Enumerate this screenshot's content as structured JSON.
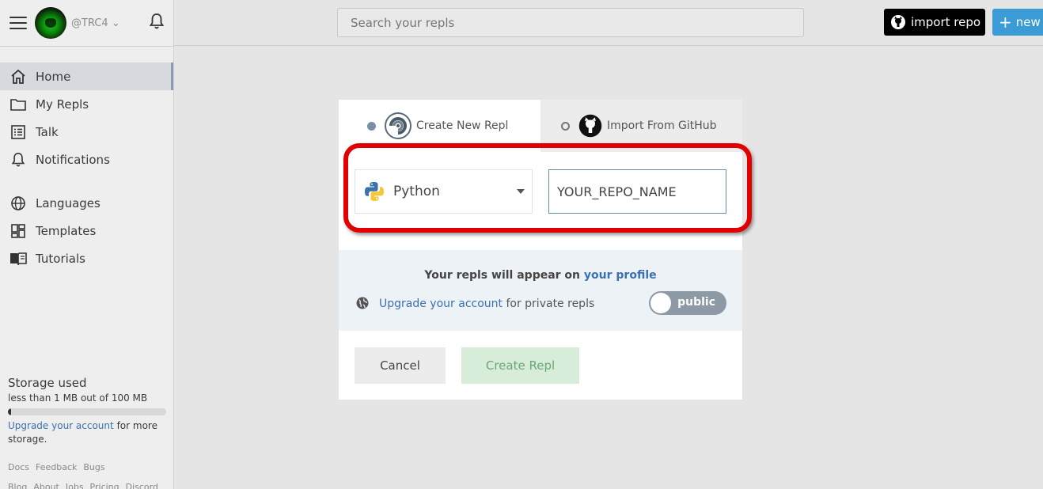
{
  "sidebar": {
    "username": "@TRC4",
    "nav_primary": [
      {
        "label": "Home",
        "icon": "home-icon",
        "active": true
      },
      {
        "label": "My Repls",
        "icon": "folder-icon",
        "active": false
      },
      {
        "label": "Talk",
        "icon": "talk-icon",
        "active": false
      },
      {
        "label": "Notifications",
        "icon": "bell-icon",
        "active": false
      }
    ],
    "nav_secondary": [
      {
        "label": "Languages",
        "icon": "globe-icon"
      },
      {
        "label": "Templates",
        "icon": "templates-icon"
      },
      {
        "label": "Tutorials",
        "icon": "book-icon"
      }
    ],
    "storage": {
      "title": "Storage used",
      "subtitle": "less than 1 MB out of 100 MB",
      "used_fraction": 0.01,
      "upgrade_link": "Upgrade your account",
      "upgrade_suffix": "for more storage."
    },
    "footer_links": [
      "Docs",
      "Feedback",
      "Bugs"
    ],
    "footer_links2": [
      "Blog",
      "About",
      "Jobs",
      "Pricing",
      "Discord"
    ]
  },
  "topbar": {
    "search_placeholder": "Search your repls",
    "import_label": "import repo",
    "new_label": "new"
  },
  "modal": {
    "tab_create": "Create New Repl",
    "tab_import": "Import From GitHub",
    "language": "Python",
    "repl_name": "YOUR_REPO_NAME",
    "info_text": "Your repls will appear on",
    "info_link": "your profile",
    "upgrade_link": "Upgrade your account",
    "upgrade_suffix": "for private repls",
    "toggle_label": "public",
    "cancel_label": "Cancel",
    "create_label": "Create Repl"
  },
  "colors": {
    "accent_blue": "#3b9bd5",
    "link_blue": "#3a70b0",
    "highlight_red": "#e00000",
    "create_green": "#d7edd9"
  }
}
